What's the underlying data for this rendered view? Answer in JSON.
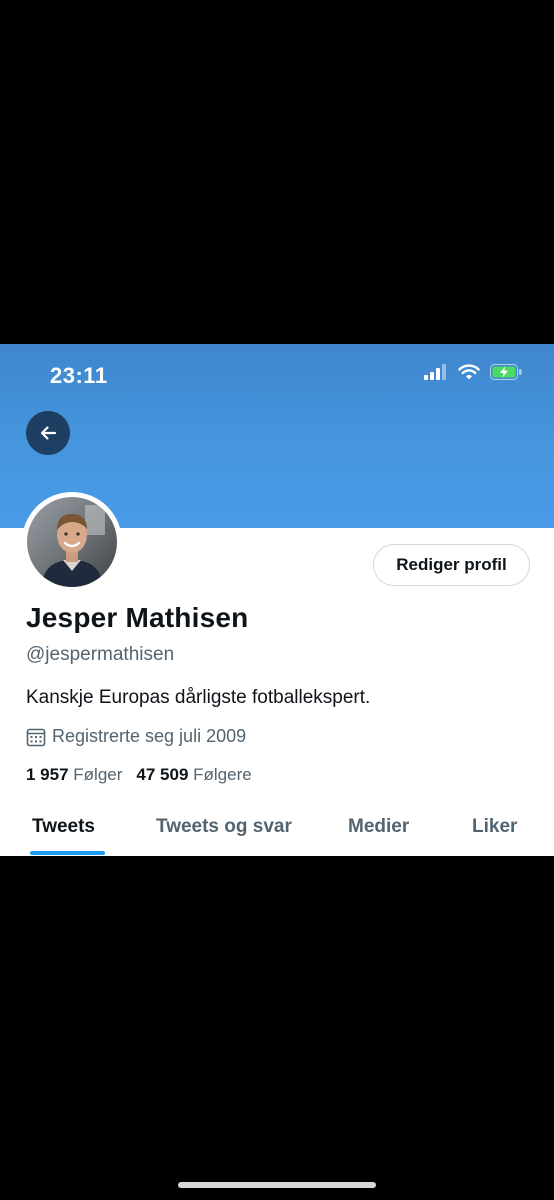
{
  "status_bar": {
    "time": "23:11"
  },
  "icons": {
    "back": "arrow-left-icon",
    "signal": "cellular-signal-icon",
    "wifi": "wifi-icon",
    "battery": "battery-charging-icon",
    "calendar": "calendar-icon"
  },
  "colors": {
    "banner": "#4596de",
    "accent": "#1d9bf0",
    "battery": "#4cd964"
  },
  "profile": {
    "edit_button": "Rediger profil",
    "name": "Jesper Mathisen",
    "handle": "@jespermathisen",
    "bio": "Kanskje Europas dårligste fotballekspert.",
    "joined": "Registrerte seg juli 2009"
  },
  "stats": {
    "following_count": "1 957",
    "following_label": "Følger",
    "followers_count": "47 509",
    "followers_label": "Følgere"
  },
  "tabs": [
    {
      "label": "Tweets",
      "active": true
    },
    {
      "label": "Tweets og svar",
      "active": false
    },
    {
      "label": "Medier",
      "active": false
    },
    {
      "label": "Liker",
      "active": false
    }
  ]
}
